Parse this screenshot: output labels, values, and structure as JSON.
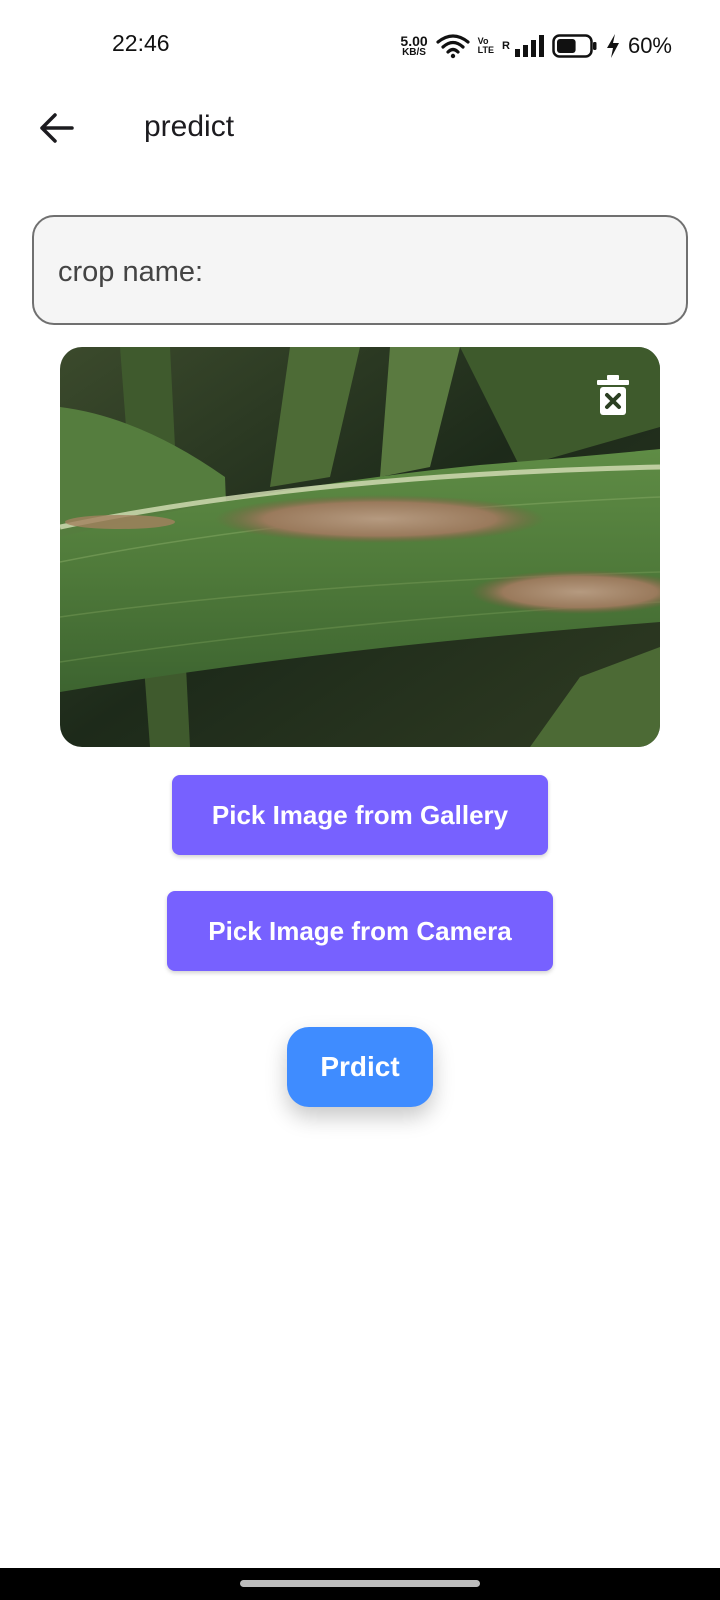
{
  "status_bar": {
    "time": "22:46",
    "net_speed_value": "5.00",
    "net_speed_unit": "KB/S",
    "volte_top": "Vo",
    "volte_bottom": "LTE",
    "roaming": "R",
    "battery_percent": "60%",
    "battery_level": 0.6,
    "icons": [
      "wifi-icon",
      "signal-icon",
      "battery-icon",
      "charging-icon"
    ]
  },
  "app_bar": {
    "title": "predict",
    "back_icon": "arrow-left-icon"
  },
  "crop_field": {
    "placeholder": "crop name:",
    "value": ""
  },
  "image_preview": {
    "delete_icon": "trash-icon"
  },
  "buttons": {
    "gallery": "Pick Image from Gallery",
    "camera": "Pick Image from Camera",
    "predict": "Prdict"
  },
  "colors": {
    "purple_button": "#7761ff",
    "predict_button": "#3f8cff"
  }
}
